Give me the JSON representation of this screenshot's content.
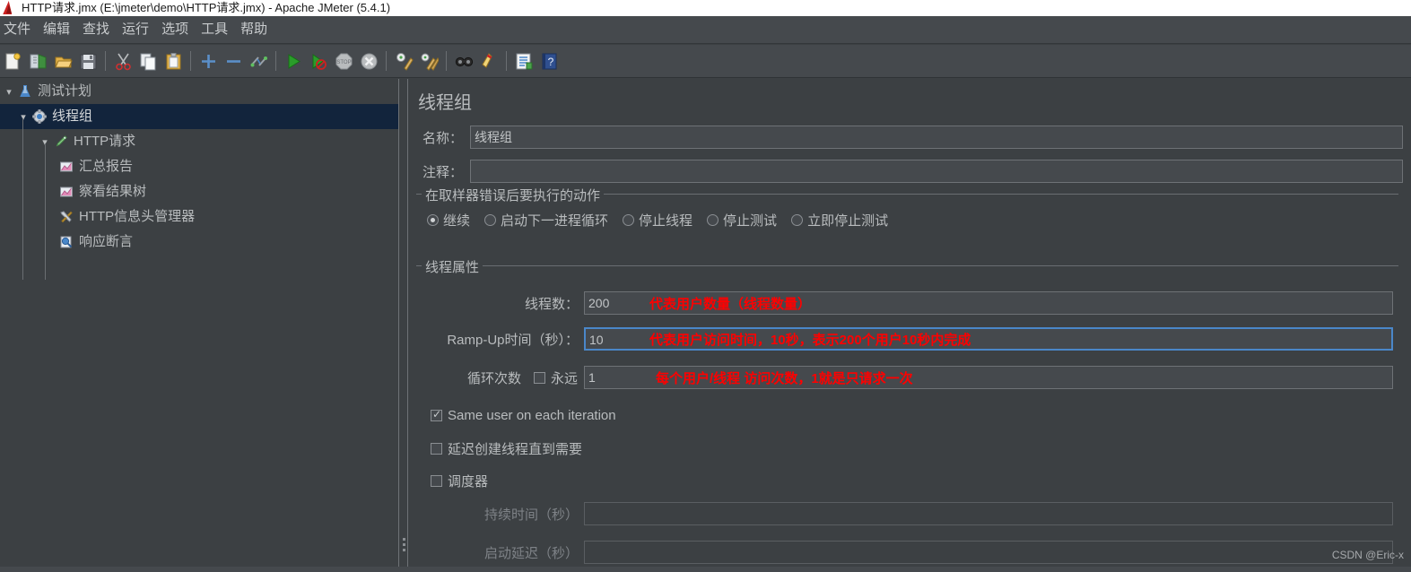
{
  "window": {
    "title": "HTTP请求.jmx (E:\\jmeter\\demo\\HTTP请求.jmx) - Apache JMeter (5.4.1)",
    "logo_icon": "jmeter-flame-logo"
  },
  "menubar": {
    "items": [
      {
        "label": "文件",
        "name": "menu-file"
      },
      {
        "label": "编辑",
        "name": "menu-edit"
      },
      {
        "label": "查找",
        "name": "menu-search"
      },
      {
        "label": "运行",
        "name": "menu-run"
      },
      {
        "label": "选项",
        "name": "menu-options"
      },
      {
        "label": "工具",
        "name": "menu-tools"
      },
      {
        "label": "帮助",
        "name": "menu-help"
      }
    ]
  },
  "toolbar": {
    "groups": [
      [
        "new-icon",
        "templates-icon",
        "open-icon",
        "save-icon"
      ],
      [
        "cut-icon",
        "copy-icon",
        "paste-icon"
      ],
      [
        "expand-icon",
        "collapse-icon",
        "toggle-icon"
      ],
      [
        "start-icon",
        "start-no-pauses-icon",
        "stop-icon",
        "shutdown-icon"
      ],
      [
        "clear-icon",
        "clear-all-icon"
      ],
      [
        "search-icon",
        "search-reset-icon"
      ],
      [
        "function-helper-icon",
        "help-icon"
      ]
    ]
  },
  "tree": {
    "nodes": [
      {
        "label": "测试计划",
        "icon": "test-plan-icon",
        "indent": 0,
        "twisty": "down",
        "selected": false,
        "name": "tree-node-test-plan"
      },
      {
        "label": "线程组",
        "icon": "thread-group-icon",
        "indent": 1,
        "twisty": "down",
        "selected": true,
        "name": "tree-node-thread-group"
      },
      {
        "label": "HTTP请求",
        "icon": "http-request-icon",
        "indent": 2,
        "twisty": "down",
        "selected": false,
        "name": "tree-node-http-request"
      },
      {
        "label": "汇总报告",
        "icon": "summary-report-icon",
        "indent": 3,
        "twisty": "",
        "selected": false,
        "name": "tree-node-summary-report"
      },
      {
        "label": "察看结果树",
        "icon": "view-results-tree-icon",
        "indent": 3,
        "twisty": "",
        "selected": false,
        "name": "tree-node-view-results-tree"
      },
      {
        "label": "HTTP信息头管理器",
        "icon": "header-manager-icon",
        "indent": 3,
        "twisty": "",
        "selected": false,
        "name": "tree-node-header-manager"
      },
      {
        "label": "响应断言",
        "icon": "response-assertion-icon",
        "indent": 3,
        "twisty": "",
        "selected": false,
        "name": "tree-node-response-assertion"
      }
    ]
  },
  "panel": {
    "title": "线程组",
    "name_label": "名称：",
    "name_value": "线程组",
    "comment_label": "注释：",
    "comment_value": "",
    "on_error": {
      "group_title": "在取样器错误后要执行的动作",
      "options": [
        {
          "label": "继续",
          "checked": true,
          "name": "radio-continue"
        },
        {
          "label": "启动下一进程循环",
          "checked": false,
          "name": "radio-start-next-loop"
        },
        {
          "label": "停止线程",
          "checked": false,
          "name": "radio-stop-thread"
        },
        {
          "label": "停止测试",
          "checked": false,
          "name": "radio-stop-test"
        },
        {
          "label": "立即停止测试",
          "checked": false,
          "name": "radio-stop-test-now"
        }
      ]
    },
    "thread_props": {
      "group_title": "线程属性",
      "num_threads_label": "线程数：",
      "num_threads_value": "200",
      "ramp_up_label": "Ramp-Up时间（秒）：",
      "ramp_up_value": "10",
      "loop_count_label": "循环次数",
      "forever_label": "永远",
      "forever_checked": false,
      "loop_count_value": "1",
      "same_user_label": "Same user on each iteration",
      "same_user_checked": true,
      "delay_create_label": "延迟创建线程直到需要",
      "delay_create_checked": false,
      "scheduler_label": "调度器",
      "scheduler_checked": false,
      "duration_label": "持续时间（秒）",
      "duration_value": "",
      "startup_delay_label": "启动延迟（秒）",
      "startup_delay_value": ""
    }
  },
  "annotations": [
    {
      "text": "代表用户数量（线程数量）",
      "name": "annotation-num-threads"
    },
    {
      "text": "代表用户访问时间，10秒，表示200个用户10秒内完成",
      "name": "annotation-ramp-up"
    },
    {
      "text": "每个用户/线程 访问次数，1就是只请求一次",
      "name": "annotation-loop-count"
    }
  ],
  "watermark": "CSDN @Eric-x",
  "colors": {
    "panel_bg": "#3c4043",
    "chrome_bg": "#45494d",
    "selection": "#12243c",
    "focus_border": "#4a87c9",
    "annotation": "#ff0000",
    "text": "#b9bcbe"
  }
}
